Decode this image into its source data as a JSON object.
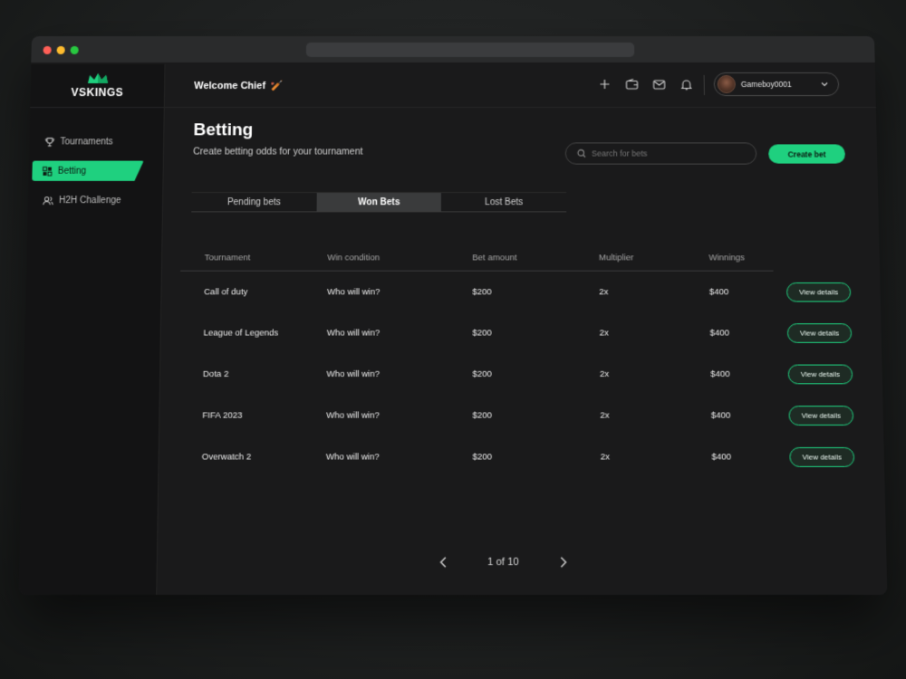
{
  "brand": {
    "name": "VSKINGS",
    "accent": "#1fd07f"
  },
  "sidebar": {
    "items": [
      {
        "label": "Tournaments",
        "icon": "trophy-icon",
        "active": false
      },
      {
        "label": "Betting",
        "icon": "betting-icon",
        "active": true
      },
      {
        "label": "H2H Challenge",
        "icon": "users-icon",
        "active": false
      }
    ]
  },
  "header": {
    "welcome": "Welcome Chief",
    "welcome_emoji": "🏏",
    "icons": [
      "plus-icon",
      "wallet-icon",
      "mail-icon",
      "bell-icon"
    ],
    "user": {
      "name": "Gameboy0001"
    }
  },
  "page": {
    "title": "Betting",
    "subtitle": "Create betting odds for your tournament",
    "search_placeholder": "Search for bets",
    "create_label": "Create bet"
  },
  "tabs": [
    {
      "label": "Pending bets",
      "active": false
    },
    {
      "label": "Won Bets",
      "active": true
    },
    {
      "label": "Lost Bets",
      "active": false
    }
  ],
  "table": {
    "columns": [
      "Tournament",
      "Win condition",
      "Bet amount",
      "Multiplier",
      "Winnings"
    ],
    "action_label": "View details",
    "rows": [
      [
        "Call of duty",
        "Who will win?",
        "$200",
        "2x",
        "$400"
      ],
      [
        "League of Legends",
        "Who will win?",
        "$200",
        "2x",
        "$400"
      ],
      [
        "Dota 2",
        "Who will win?",
        "$200",
        "2x",
        "$400"
      ],
      [
        "FIFA 2023",
        "Who will win?",
        "$200",
        "2x",
        "$400"
      ],
      [
        "Overwatch 2",
        "Who will win?",
        "$200",
        "2x",
        "$400"
      ]
    ]
  },
  "pagination": {
    "label": "1 of 10"
  }
}
